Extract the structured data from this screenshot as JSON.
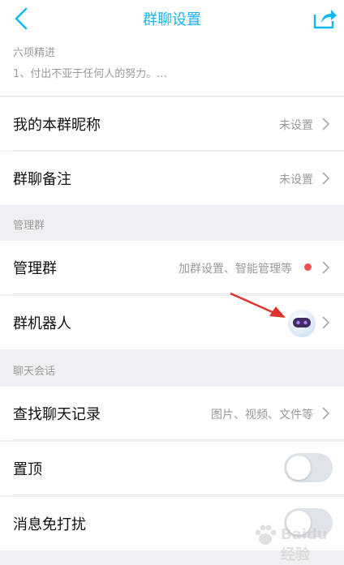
{
  "header": {
    "title": "群聊设置",
    "back_icon": "chevron-left-icon",
    "share_icon": "share-icon"
  },
  "announcement": {
    "title": "六项精进",
    "text": "1、付出不亚于任何人的努力。..."
  },
  "rows": {
    "nickname": {
      "label": "我的本群昵称",
      "value": "未设置"
    },
    "remark": {
      "label": "群聊备注",
      "value": "未设置"
    },
    "manage": {
      "label": "管理群",
      "value": "加群设置、智能管理等",
      "badge": "red-dot"
    },
    "robot": {
      "label": "群机器人",
      "avatar": "robot-avatar-icon"
    },
    "history": {
      "label": "查找聊天记录",
      "value": "图片、视频、文件等"
    },
    "pin": {
      "label": "置顶",
      "state": "off"
    },
    "mute": {
      "label": "消息免打扰",
      "state": "off"
    }
  },
  "sections": {
    "manage": "管理群",
    "chat": "聊天会话"
  },
  "watermark": {
    "brand": "Baidu",
    "suffix": "经验"
  },
  "colors": {
    "accent": "#12b7f5",
    "background": "#eef0f4",
    "badge": "#f0504f",
    "pointer_arrow": "#e0312b"
  }
}
